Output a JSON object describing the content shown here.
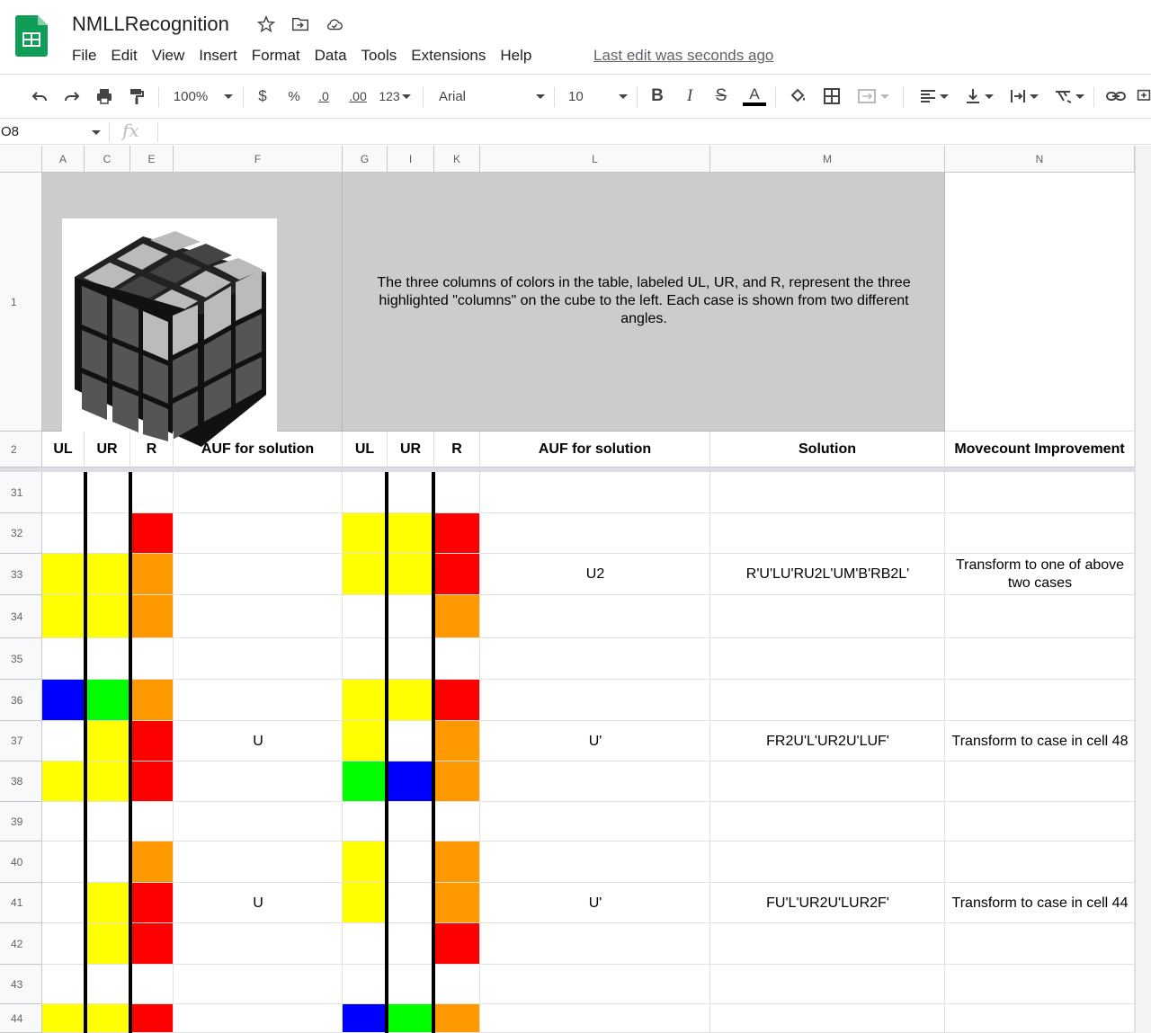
{
  "app": {
    "doc_title": "NMLLRecognition",
    "menu": [
      "File",
      "Edit",
      "View",
      "Insert",
      "Format",
      "Data",
      "Tools",
      "Extensions",
      "Help"
    ],
    "last_edit": "Last edit was seconds ago"
  },
  "toolbar": {
    "zoom": "100%",
    "currency": "$",
    "percent": "%",
    "dec_decrease": ".0",
    "dec_increase": ".00",
    "more_formats": "123",
    "font": "Arial",
    "font_size": "10"
  },
  "formula_bar": {
    "name_box": "O8",
    "fx": "fx",
    "formula": ""
  },
  "grid": {
    "columns": [
      "A",
      "C",
      "E",
      "F",
      "G",
      "I",
      "K",
      "L",
      "M",
      "N"
    ],
    "banner_text": "The three columns of colors in the table, labeled UL, UR, and R, represent the three highlighted \"columns\" on the cube to the left.  Each case is shown from two different angles.",
    "header_row": {
      "number": "2",
      "cells": [
        "UL",
        "UR",
        "R",
        "AUF for solution",
        "UL",
        "UR",
        "R",
        "AUF for solution",
        "Solution",
        "Movecount Improvement"
      ]
    },
    "row1_number": "1",
    "rows": [
      {
        "n": "31",
        "colors": [
          "",
          "",
          "",
          "",
          "",
          ""
        ]
      },
      {
        "n": "32",
        "colors": [
          "",
          "",
          "red",
          "yellow",
          "yellow",
          "red"
        ]
      },
      {
        "n": "33",
        "colors": [
          "yellow",
          "yellow",
          "orange",
          "yellow",
          "yellow",
          "red"
        ]
      },
      {
        "n": "34",
        "colors": [
          "yellow",
          "yellow",
          "orange",
          "",
          "",
          "orange"
        ]
      },
      {
        "n": "35",
        "colors": [
          "",
          "",
          "",
          "",
          "",
          ""
        ]
      },
      {
        "n": "36",
        "colors": [
          "blue",
          "green",
          "orange",
          "yellow",
          "yellow",
          "red"
        ]
      },
      {
        "n": "37",
        "colors": [
          "",
          "yellow",
          "red",
          "yellow",
          "",
          "orange"
        ]
      },
      {
        "n": "38",
        "colors": [
          "yellow",
          "yellow",
          "red",
          "green",
          "blue",
          "orange"
        ]
      },
      {
        "n": "39",
        "colors": [
          "",
          "",
          "",
          "",
          "",
          ""
        ]
      },
      {
        "n": "40",
        "colors": [
          "",
          "",
          "orange",
          "yellow",
          "",
          "orange"
        ]
      },
      {
        "n": "41",
        "colors": [
          "",
          "yellow",
          "red",
          "yellow",
          "",
          "orange"
        ]
      },
      {
        "n": "42",
        "colors": [
          "",
          "yellow",
          "red",
          "",
          "",
          "red"
        ]
      },
      {
        "n": "43",
        "colors": [
          "",
          "",
          "",
          "",
          "",
          ""
        ]
      },
      {
        "n": "44",
        "colors": [
          "yellow",
          "yellow",
          "red",
          "blue",
          "green",
          "orange"
        ]
      }
    ],
    "cases": [
      {
        "row": 2,
        "auf1": "",
        "auf2": "U2",
        "solution": "R'U'LU'RU2L'UM'B'RB2L'",
        "improvement": "Transform to one of above two cases"
      },
      {
        "row": 6,
        "auf1": "U",
        "auf2": "U'",
        "solution": "FR2U'L'UR2U'LUF'",
        "improvement": "Transform to case in cell 48"
      },
      {
        "row": 10,
        "auf1": "U",
        "auf2": "U'",
        "solution": "FU'L'UR2U'LUR2F'",
        "improvement": "Transform to case in cell 44"
      }
    ]
  },
  "colors": {
    "red": "#ff0000",
    "orange": "#ff9900",
    "yellow": "#ffff00",
    "green": "#00ff00",
    "blue": "#0000ff",
    "banner_gray": "#cccccc",
    "sheets_green": "#0f9d58"
  }
}
